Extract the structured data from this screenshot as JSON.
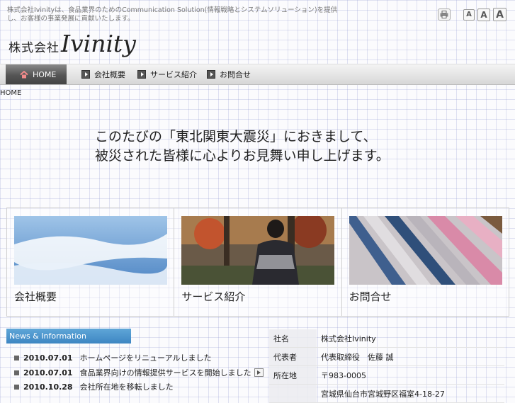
{
  "header": {
    "tagline": "株式会社Ivinityは、食品業界のためのCommunication Solution(情報戦略とシステムソリューション)を提供し、お客様の事業発展に貢献いたします。",
    "logo_jp": "株式会社",
    "logo_en": "Ivinity",
    "font_sizes": [
      "A",
      "A",
      "A"
    ]
  },
  "nav": {
    "items": [
      {
        "label": "HOME",
        "icon": "home-icon"
      },
      {
        "label": "会社概要",
        "icon": "arrow-icon"
      },
      {
        "label": "サービス紹介",
        "icon": "arrow-icon"
      },
      {
        "label": "お問合せ",
        "icon": "arrow-icon"
      }
    ]
  },
  "breadcrumb": "HOME",
  "banner": {
    "line1": "このたびの「東北関東大震災」におきまして、",
    "line2": "被災された皆様に心よりお見舞い申し上げます。"
  },
  "tiles": [
    {
      "label": "会社概要"
    },
    {
      "label": "サービス紹介"
    },
    {
      "label": "お問合せ"
    }
  ],
  "news": {
    "title": "News & Information",
    "items": [
      {
        "date": "2010.07.01",
        "text": "ホームページをリニューアルしました"
      },
      {
        "date": "2010.07.01",
        "text": "食品業界向けの情報提供サービスを開始しました"
      },
      {
        "date": "2010.10.28",
        "text": "会社所在地を移転しました"
      }
    ]
  },
  "company": {
    "rows": [
      {
        "key": "社名",
        "value": "株式会社Ivinity"
      },
      {
        "key": "代表者",
        "value": "代表取締役　佐藤 誠"
      },
      {
        "key": "所在地",
        "value": "〒983-0005"
      },
      {
        "key": "",
        "value": "宮城県仙台市宮城野区福室4-18-27"
      }
    ]
  },
  "colors": {
    "accent": "#3d86c2",
    "nav_active": "#555555"
  }
}
